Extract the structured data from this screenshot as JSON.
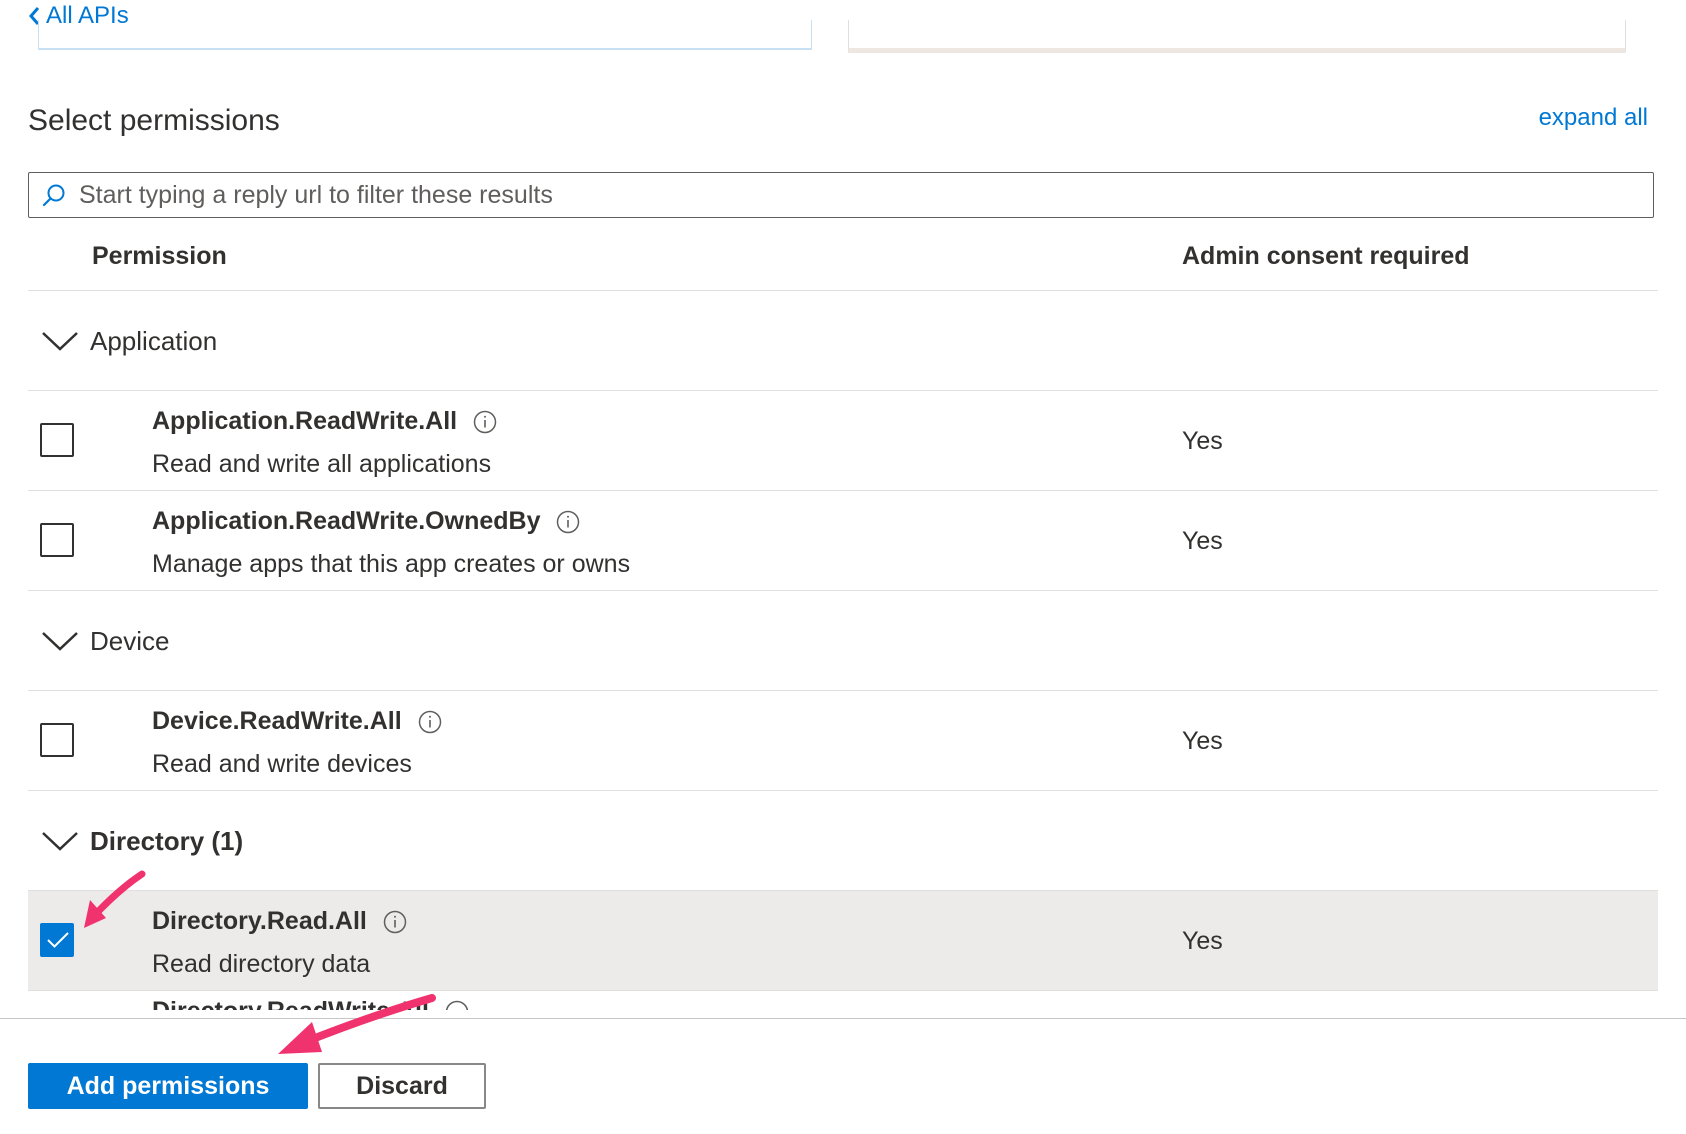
{
  "nav": {
    "back_label": "All APIs"
  },
  "permissions_panel": {
    "title": "Select permissions",
    "expand_all_label": "expand all",
    "filter_placeholder": "Start typing a reply url to filter these results",
    "columns": {
      "permission": "Permission",
      "admin_consent": "Admin consent required"
    },
    "groups": [
      {
        "label": "Application",
        "expanded": true,
        "items": [
          {
            "name": "Application.ReadWrite.All",
            "description": "Read and write all applications",
            "admin_consent": "Yes",
            "checked": false
          },
          {
            "name": "Application.ReadWrite.OwnedBy",
            "description": "Manage apps that this app creates or owns",
            "admin_consent": "Yes",
            "checked": false
          }
        ]
      },
      {
        "label": "Device",
        "expanded": true,
        "items": [
          {
            "name": "Device.ReadWrite.All",
            "description": "Read and write devices",
            "admin_consent": "Yes",
            "checked": false
          }
        ]
      },
      {
        "label": "Directory (1)",
        "expanded": true,
        "items": [
          {
            "name": "Directory.Read.All",
            "description": "Read directory data",
            "admin_consent": "Yes",
            "checked": true
          },
          {
            "name": "Directory.ReadWrite.All"
          }
        ]
      }
    ]
  },
  "footer": {
    "add_label": "Add permissions",
    "discard_label": "Discard"
  },
  "colors": {
    "accent": "#0078d4",
    "annotation_arrow": "#f0336e",
    "selected_row": "#edebe9"
  },
  "icons": {
    "back": "chevron-left-icon",
    "search": "search-icon",
    "group_toggle": "chevron-down-icon",
    "info": "info-icon",
    "check": "checkmark-icon"
  }
}
